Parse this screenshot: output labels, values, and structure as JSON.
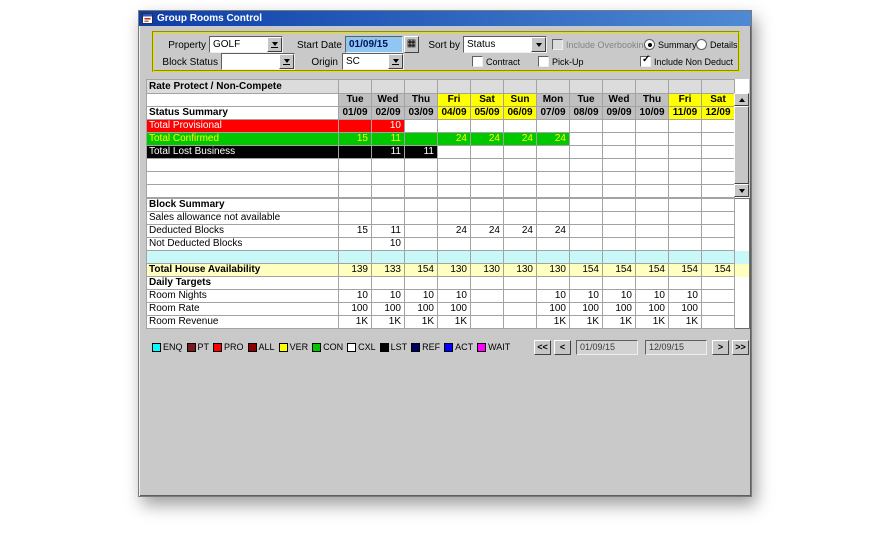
{
  "window": {
    "title": "Group Rooms Control"
  },
  "filters": {
    "property": {
      "label": "Property",
      "value": "GOLF"
    },
    "start_date": {
      "label": "Start Date",
      "value": "01/09/15"
    },
    "sort_by": {
      "label": "Sort by",
      "value": "Status"
    },
    "include_overbooking": {
      "label": "Include Overbooking",
      "checked": false,
      "disabled": true
    },
    "summary": {
      "label": "Summary",
      "selected": true
    },
    "details": {
      "label": "Details",
      "selected": false
    },
    "block_status": {
      "label": "Block Status",
      "value": ""
    },
    "origin": {
      "label": "Origin",
      "value": "SC"
    },
    "contract": {
      "label": "Contract",
      "checked": false
    },
    "pick_up": {
      "label": "Pick-Up",
      "checked": false
    },
    "include_non_deduct": {
      "label": "Include Non Deduct",
      "checked": true
    }
  },
  "grid": {
    "corner_label": "Rate Protect / Non-Compete",
    "day_names": [
      "Tue",
      "Wed",
      "Thu",
      "Fri",
      "Sat",
      "Sun",
      "Mon",
      "Tue",
      "Wed",
      "Thu",
      "Fri",
      "Sat"
    ],
    "weekend": [
      false,
      false,
      false,
      true,
      true,
      true,
      false,
      false,
      false,
      false,
      true,
      true
    ],
    "status_section_label": "Status Summary",
    "dates": [
      "01/09",
      "02/09",
      "03/09",
      "04/09",
      "05/09",
      "06/09",
      "07/09",
      "08/09",
      "09/09",
      "10/09",
      "11/09",
      "12/09"
    ],
    "status_rows": [
      {
        "label": "Total Provisional",
        "style": "provisional",
        "band_cols": 2,
        "values": [
          "",
          "10",
          "",
          "",
          "",
          "",
          "",
          "",
          "",
          "",
          "",
          ""
        ]
      },
      {
        "label": "Total Confirmed",
        "style": "confirmed",
        "band_cols": 7,
        "values": [
          "15",
          "11",
          "",
          "24",
          "24",
          "24",
          "24",
          "",
          "",
          "",
          "",
          ""
        ]
      },
      {
        "label": "Total Lost Business",
        "style": "lost",
        "band_cols": 3,
        "values": [
          "",
          "11",
          "11",
          "",
          "",
          "",
          "",
          "",
          "",
          "",
          "",
          ""
        ]
      },
      {
        "label": "",
        "style": "",
        "band_cols": 0,
        "values": [
          "",
          "",
          "",
          "",
          "",
          "",
          "",
          "",
          "",
          "",
          "",
          ""
        ]
      },
      {
        "label": "",
        "style": "",
        "band_cols": 0,
        "values": [
          "",
          "",
          "",
          "",
          "",
          "",
          "",
          "",
          "",
          "",
          "",
          ""
        ]
      },
      {
        "label": "",
        "style": "",
        "band_cols": 0,
        "values": [
          "",
          "",
          "",
          "",
          "",
          "",
          "",
          "",
          "",
          "",
          "",
          ""
        ]
      }
    ],
    "block_rows": [
      {
        "label": "Block Summary",
        "bold": true,
        "style": "",
        "values": [
          "",
          "",
          "",
          "",
          "",
          "",
          "",
          "",
          "",
          "",
          "",
          ""
        ]
      },
      {
        "label": "Sales allowance not available",
        "bold": false,
        "style": "",
        "values": [
          "",
          "",
          "",
          "",
          "",
          "",
          "",
          "",
          "",
          "",
          "",
          ""
        ]
      },
      {
        "label": "Deducted Blocks",
        "bold": false,
        "style": "",
        "values": [
          "15",
          "11",
          "",
          "24",
          "24",
          "24",
          "24",
          "",
          "",
          "",
          "",
          ""
        ]
      },
      {
        "label": "Not Deducted Blocks",
        "bold": false,
        "style": "",
        "values": [
          "",
          "10",
          "",
          "",
          "",
          "",
          "",
          "",
          "",
          "",
          "",
          ""
        ]
      },
      {
        "label": "",
        "bold": false,
        "style": "cyan",
        "values": [
          "",
          "",
          "",
          "",
          "",
          "",
          "",
          "",
          "",
          "",
          "",
          ""
        ]
      },
      {
        "label": "Total House Availability",
        "bold": true,
        "style": "avail",
        "values": [
          "139",
          "133",
          "154",
          "130",
          "130",
          "130",
          "130",
          "154",
          "154",
          "154",
          "154",
          "154"
        ]
      },
      {
        "label": "Daily Targets",
        "bold": true,
        "style": "",
        "values": [
          "",
          "",
          "",
          "",
          "",
          "",
          "",
          "",
          "",
          "",
          "",
          ""
        ]
      },
      {
        "label": "Room Nights",
        "bold": false,
        "style": "",
        "values": [
          "10",
          "10",
          "10",
          "10",
          "",
          "",
          "10",
          "10",
          "10",
          "10",
          "10",
          ""
        ]
      },
      {
        "label": "Room Rate",
        "bold": false,
        "style": "",
        "values": [
          "100",
          "100",
          "100",
          "100",
          "",
          "",
          "100",
          "100",
          "100",
          "100",
          "100",
          ""
        ]
      },
      {
        "label": "Room Revenue",
        "bold": false,
        "style": "",
        "values": [
          "1K",
          "1K",
          "1K",
          "1K",
          "",
          "",
          "1K",
          "1K",
          "1K",
          "1K",
          "1K",
          ""
        ]
      }
    ]
  },
  "legend": [
    {
      "code": "ENQ",
      "color": "#00ffff"
    },
    {
      "code": "PT",
      "color": "#7b1a1a"
    },
    {
      "code": "PRO",
      "color": "#ff0000"
    },
    {
      "code": "ALL",
      "color": "#8b0000"
    },
    {
      "code": "VER",
      "color": "#ffff00"
    },
    {
      "code": "CON",
      "color": "#00c800"
    },
    {
      "code": "CXL",
      "color": "#ffffff"
    },
    {
      "code": "LST",
      "color": "#000000"
    },
    {
      "code": "REF",
      "color": "#000060"
    },
    {
      "code": "ACT",
      "color": "#0000ff"
    },
    {
      "code": "WAIT",
      "color": "#ff00ff"
    }
  ],
  "nav": {
    "first_label": "<<",
    "prev_label": "<",
    "from_value": "01/09/15",
    "to_value": "12/09/15",
    "next_label": ">",
    "last_label": ">>"
  },
  "colors": {
    "weekend_header": "#ffff00",
    "provisional_row": "#ff0000",
    "confirmed_row": "#00c800",
    "lost_row": "#000000",
    "availability_row": "#ffffc0",
    "spacer_row": "#c8f8f8",
    "titlebar": "#0d3ea8"
  }
}
